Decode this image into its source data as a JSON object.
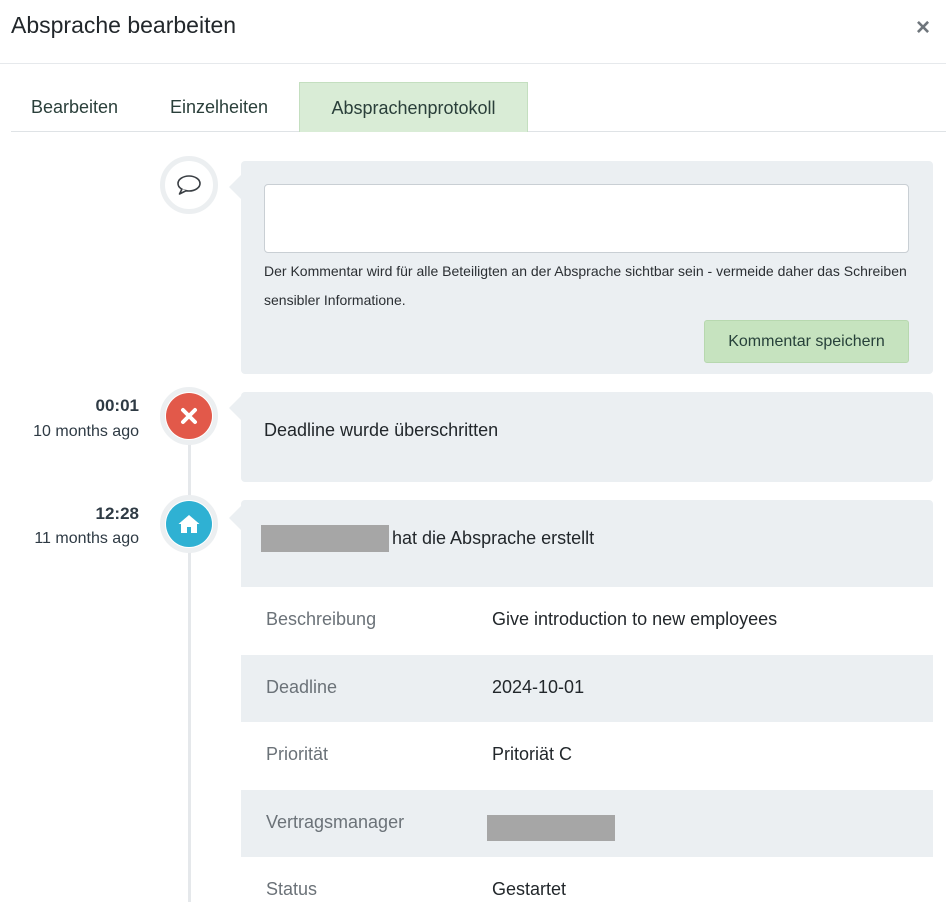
{
  "modal": {
    "title": "Absprache bearbeiten",
    "close_icon": "×"
  },
  "tabs": [
    {
      "label": "Bearbeiten",
      "active": false
    },
    {
      "label": "Einzelheiten",
      "active": false
    },
    {
      "label": "Absprachenprotokoll",
      "active": true
    }
  ],
  "comment": {
    "input_value": "",
    "input_placeholder": "",
    "hint": "Der Kommentar wird für alle Beteiligten an der Absprache sichtbar sein - vermeide daher das Schreiben sensibler Informatione.",
    "save_label": "Kommentar speichern"
  },
  "events": [
    {
      "time": "00:01",
      "ago": "10 months ago",
      "icon": "times-icon",
      "icon_color": "#e2594a",
      "text": "Deadline wurde überschritten"
    },
    {
      "time": "12:28",
      "ago": "11 months ago",
      "icon": "home-icon",
      "icon_color": "#2fb1d3",
      "text": "hat die Absprache erstellt",
      "details": [
        {
          "label": "Beschreibung",
          "value": "Give introduction to new employees"
        },
        {
          "label": "Deadline",
          "value": "2024-10-01"
        },
        {
          "label": "Priorität",
          "value": "Pritoriät C"
        },
        {
          "label": "Vertragsmanager",
          "value": ""
        },
        {
          "label": "Status",
          "value": "Gestartet"
        }
      ]
    }
  ],
  "colors": {
    "active_tab": "#d9ecd6",
    "save_button": "#c6e3bf",
    "panel_bg": "#ebeff2"
  }
}
